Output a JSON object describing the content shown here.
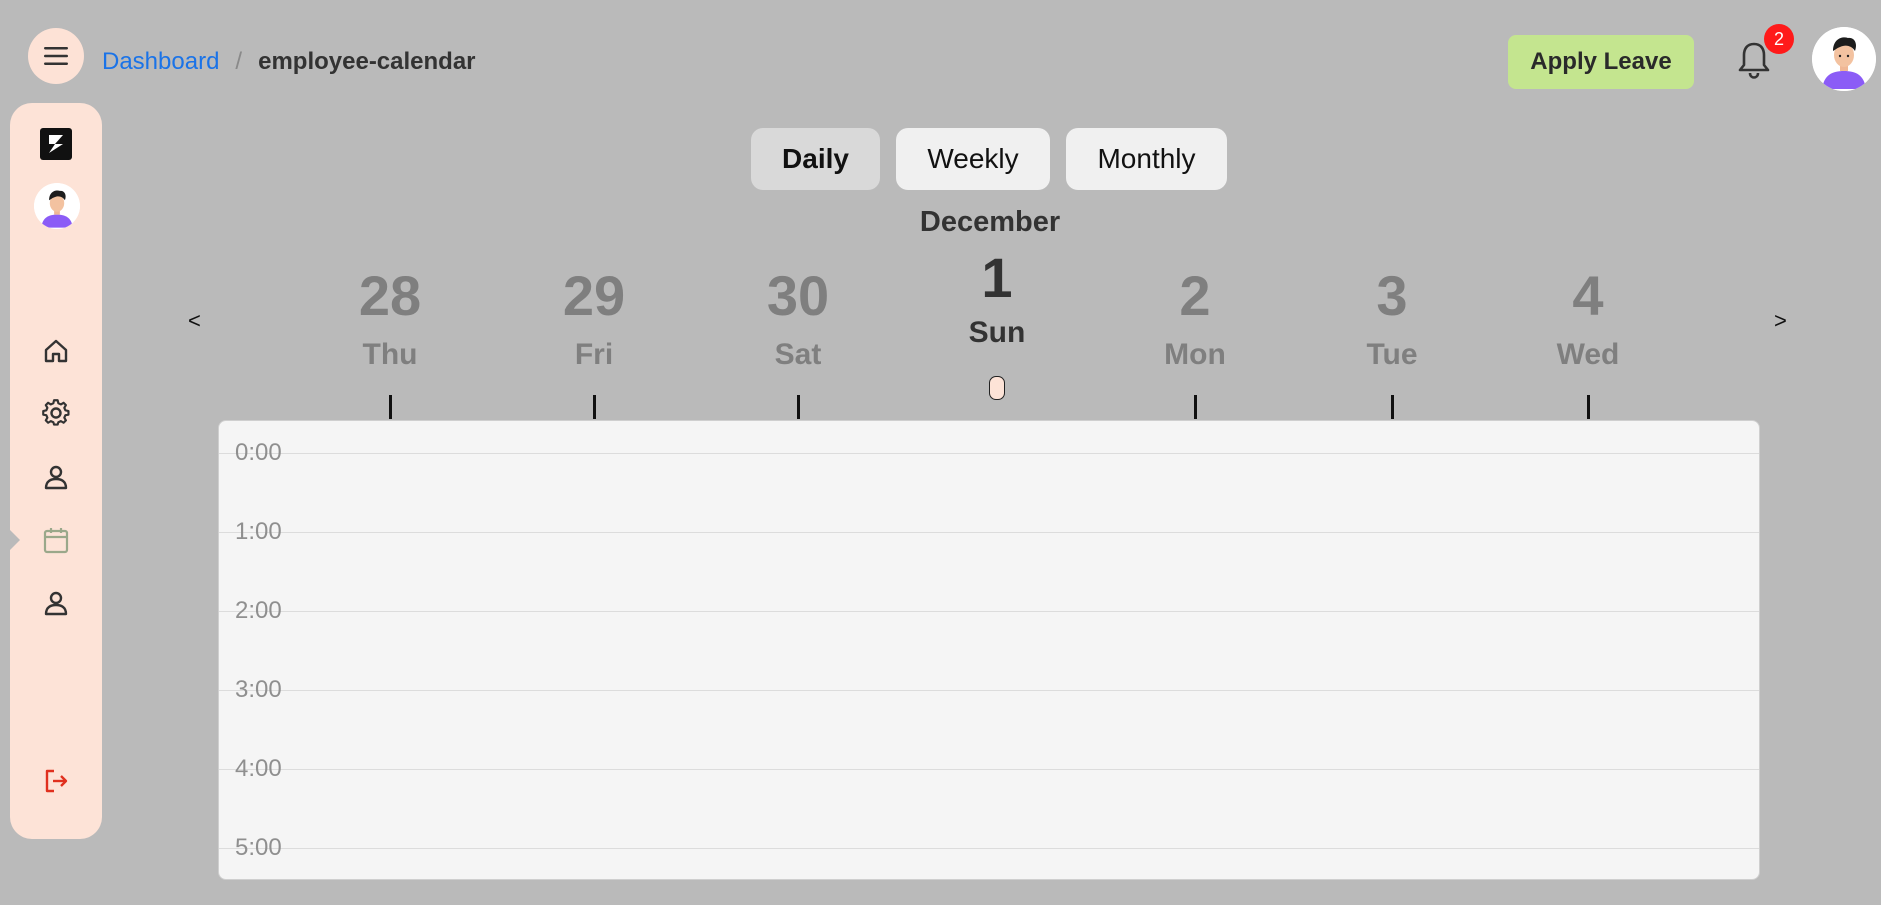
{
  "header": {
    "breadcrumb": {
      "link": "Dashboard",
      "separator": "/",
      "current": "employee-calendar"
    },
    "apply_leave_label": "Apply Leave",
    "notification_count": "2"
  },
  "sidebar": {
    "items": [
      {
        "name": "home",
        "icon": "home-icon"
      },
      {
        "name": "settings",
        "icon": "gear-icon"
      },
      {
        "name": "profile",
        "icon": "user-icon"
      },
      {
        "name": "calendar",
        "icon": "calendar-icon",
        "active": true
      },
      {
        "name": "employees",
        "icon": "user-icon"
      }
    ],
    "logout_icon": "logout-icon"
  },
  "view_toggle": {
    "daily": "Daily",
    "weekly": "Weekly",
    "monthly": "Monthly",
    "active": "Daily"
  },
  "calendar": {
    "month": "December",
    "prev": "<",
    "next": ">",
    "days": [
      {
        "num": "28",
        "name": "Thu"
      },
      {
        "num": "29",
        "name": "Fri"
      },
      {
        "num": "30",
        "name": "Sat"
      },
      {
        "num": "1",
        "name": "Sun",
        "selected": true
      },
      {
        "num": "2",
        "name": "Mon"
      },
      {
        "num": "3",
        "name": "Tue"
      },
      {
        "num": "4",
        "name": "Wed"
      }
    ],
    "hours": [
      "0:00",
      "1:00",
      "2:00",
      "3:00",
      "4:00",
      "5:00"
    ]
  },
  "colors": {
    "accent_green": "#c4e58f",
    "sidebar_bg": "#fde3d7",
    "link_blue": "#1a73e8",
    "badge_red": "#ff1a1a",
    "logout_red": "#e0301e"
  }
}
